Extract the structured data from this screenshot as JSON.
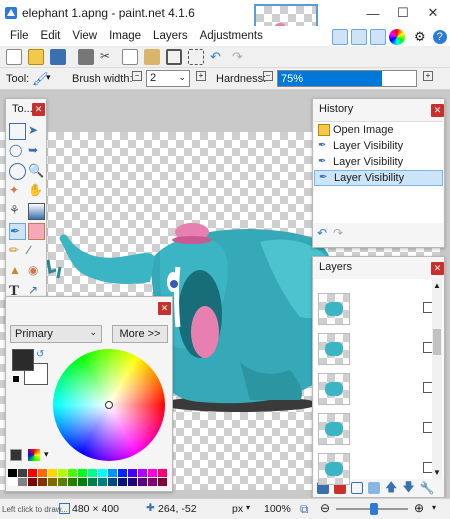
{
  "window": {
    "title": "elephant 1.apng - paint.net 4.1.6",
    "min_label": "—",
    "max_label": "☐",
    "close_label": "✕"
  },
  "menu": [
    "File",
    "Edit",
    "View",
    "Image",
    "Layers",
    "Adjustments"
  ],
  "options_bar": {
    "tool_label": "Tool:",
    "brush_width_label": "Brush width:",
    "brush_width_value": "2",
    "hardness_label": "Hardness:",
    "hardness_value": "75%",
    "hardness_fraction": 0.75
  },
  "tools_panel": {
    "title": "To..."
  },
  "history_panel": {
    "title": "History",
    "items": [
      "Open Image",
      "Layer Visibility",
      "Layer Visibility",
      "Layer Visibility"
    ],
    "selected_index": 3
  },
  "layers_panel": {
    "title": "Layers",
    "layer_count": 5
  },
  "colors_panel": {
    "mode_value": "Primary",
    "more_label": "More >>",
    "primary_color": "#2b2b2b",
    "secondary_color": "#ffffff"
  },
  "palette": [
    "#000000",
    "#404040",
    "#ff0000",
    "#ff6a00",
    "#ffd800",
    "#b6ff00",
    "#4cff00",
    "#00ff21",
    "#00ff90",
    "#00ffff",
    "#0094ff",
    "#0026ff",
    "#4800ff",
    "#b200ff",
    "#ff00dc",
    "#ff006e",
    "#ffffff",
    "#808080",
    "#7f0000",
    "#7f3300",
    "#7f6a00",
    "#5b7f00",
    "#267f00",
    "#007f0e",
    "#007f46",
    "#007f7f",
    "#004a7f",
    "#00137f",
    "#21007f",
    "#57007f",
    "#7f006e",
    "#7f0037"
  ],
  "status": {
    "hint": "Left click to draw...",
    "size": "480 × 400",
    "cursor": "264, -52",
    "unit": "px",
    "zoom": "100%"
  },
  "colors": {
    "accent": "#0078d7",
    "elephant": "#3bb5c4",
    "hat": "#e77fb0"
  }
}
